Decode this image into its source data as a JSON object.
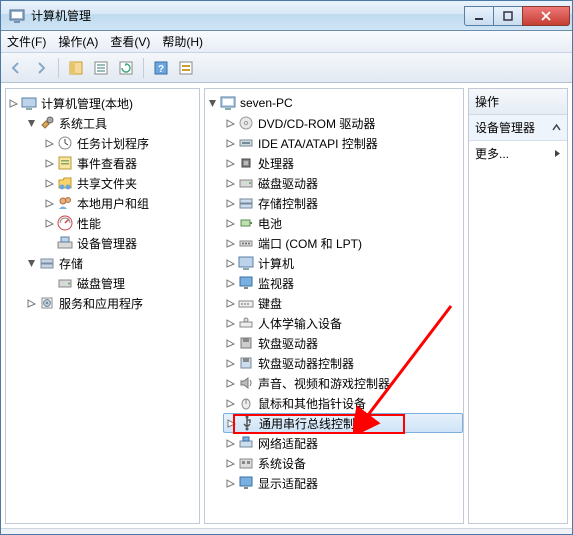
{
  "window": {
    "title": "计算机管理"
  },
  "menu": {
    "file": "文件(F)",
    "action": "操作(A)",
    "view": "查看(V)",
    "help": "帮助(H)"
  },
  "left": {
    "root": "计算机管理(本地)",
    "systools": "系统工具",
    "systools_items": {
      "scheduler": "任务计划程序",
      "eventviewer": "事件查看器",
      "sharedfolders": "共享文件夹",
      "localusers": "本地用户和组",
      "performance": "性能",
      "devmgr": "设备管理器"
    },
    "storage": "存储",
    "storage_items": {
      "diskmgmt": "磁盘管理"
    },
    "services": "服务和应用程序"
  },
  "mid": {
    "root": "seven-PC",
    "items": {
      "dvd": "DVD/CD-ROM 驱动器",
      "ide": "IDE ATA/ATAPI 控制器",
      "cpu": "处理器",
      "disk": "磁盘驱动器",
      "storagectrl": "存储控制器",
      "battery": "电池",
      "ports": "端口 (COM 和 LPT)",
      "computer": "计算机",
      "monitor": "监视器",
      "keyboard": "键盘",
      "hid": "人体学输入设备",
      "floppy": "软盘驱动器",
      "floppyctrl": "软盘驱动器控制器",
      "sound": "声音、视频和游戏控制器",
      "mouse": "鼠标和其他指针设备",
      "usb": "通用串行总线控制器",
      "net": "网络适配器",
      "system": "系统设备",
      "display": "显示适配器"
    }
  },
  "right": {
    "head": "操作",
    "subhead": "设备管理器",
    "more": "更多..."
  }
}
